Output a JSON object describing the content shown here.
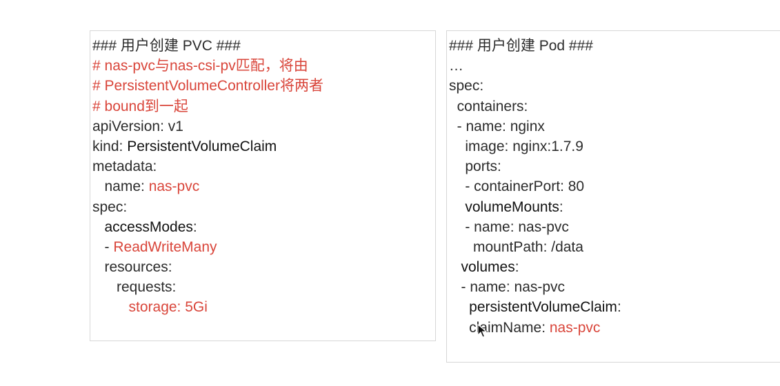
{
  "colors": {
    "accent_red": "#d9453a",
    "text": "#2b2b2b",
    "border": "#d6d6d6"
  },
  "left_panel": {
    "lines": [
      [
        {
          "text": "### 用户创建 PVC ###",
          "style": "plain"
        }
      ],
      [
        {
          "text": "# nas-pvc与nas-csi-pv匹配，将由",
          "style": "red"
        }
      ],
      [
        {
          "text": "# PersistentVolumeController将两者",
          "style": "red"
        }
      ],
      [
        {
          "text": "# bound到一起",
          "style": "red"
        }
      ],
      [
        {
          "text": "apiVersion: v1",
          "style": "plain"
        }
      ],
      [
        {
          "text": "kind: ",
          "style": "plain"
        },
        {
          "text": "PersistentVolumeClaim",
          "style": "dark"
        }
      ],
      [
        {
          "text": "metadata:",
          "style": "plain"
        }
      ],
      [
        {
          "text": "   name: ",
          "style": "plain"
        },
        {
          "text": "nas-pvc",
          "style": "red"
        }
      ],
      [
        {
          "text": "spec:",
          "style": "plain"
        }
      ],
      [
        {
          "text": "   accessModes",
          "style": "dark"
        },
        {
          "text": ":",
          "style": "plain"
        }
      ],
      [
        {
          "text": "   - ",
          "style": "plain"
        },
        {
          "text": "ReadWriteMany",
          "style": "red"
        }
      ],
      [
        {
          "text": "   resources:",
          "style": "plain"
        }
      ],
      [
        {
          "text": "      requests:",
          "style": "plain"
        }
      ],
      [
        {
          "text": "         storage: 5Gi",
          "style": "red"
        }
      ]
    ]
  },
  "right_panel": {
    "lines": [
      [
        {
          "text": "### 用户创建 Pod ###",
          "style": "plain"
        }
      ],
      [
        {
          "text": "…",
          "style": "plain"
        }
      ],
      [
        {
          "text": "spec:",
          "style": "plain"
        }
      ],
      [
        {
          "text": "  containers:",
          "style": "plain"
        }
      ],
      [
        {
          "text": "  - name: nginx",
          "style": "plain"
        }
      ],
      [
        {
          "text": "    image: nginx:1.7.9",
          "style": "plain"
        }
      ],
      [
        {
          "text": "    ports:",
          "style": "plain"
        }
      ],
      [
        {
          "text": "    - containerPort: 80",
          "style": "plain"
        }
      ],
      [
        {
          "text": "    volumeMounts",
          "style": "dark"
        },
        {
          "text": ":",
          "style": "plain"
        }
      ],
      [
        {
          "text": "    - name: nas-pvc",
          "style": "plain"
        }
      ],
      [
        {
          "text": "      mountPath: /data",
          "style": "plain"
        }
      ],
      [
        {
          "text": "   volumes",
          "style": "dark"
        },
        {
          "text": ":",
          "style": "plain"
        }
      ],
      [
        {
          "text": "   - name: nas-pvc",
          "style": "plain"
        }
      ],
      [
        {
          "text": "     persistentVolumeClaim",
          "style": "dark"
        },
        {
          "text": ":",
          "style": "plain"
        }
      ],
      [
        {
          "text": "     claimName: ",
          "style": "plain"
        },
        {
          "text": "nas-pvc",
          "style": "red"
        }
      ]
    ]
  },
  "cursor_icon": "mouse-pointer-icon"
}
